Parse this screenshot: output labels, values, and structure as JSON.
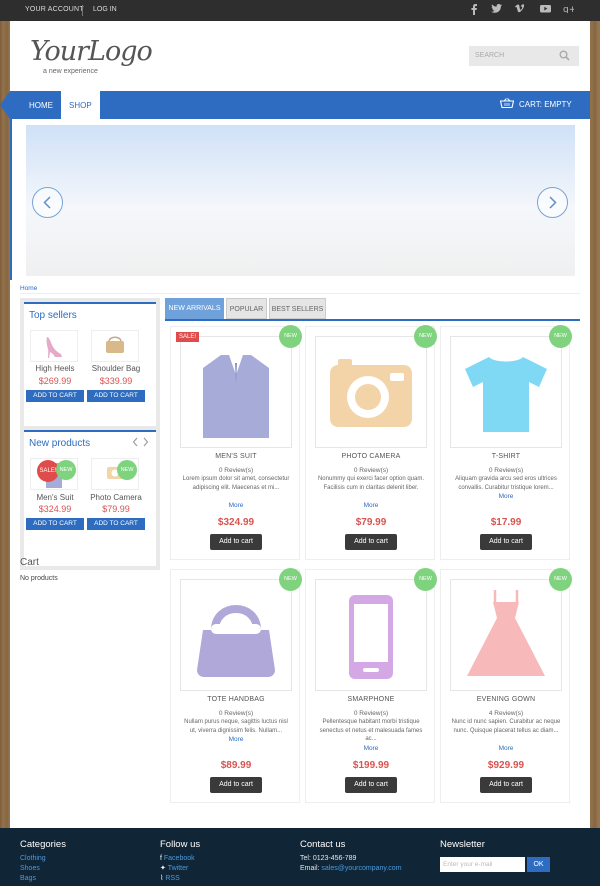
{
  "topbar": {
    "account": "YOUR ACCOUNT",
    "login": "LOG IN"
  },
  "logo": {
    "main": "YourLogo",
    "tagline": "a new experience"
  },
  "search": {
    "placeholder": "SEARCH"
  },
  "nav": {
    "home": "HOME",
    "shop": "SHOP",
    "cart": "CART: EMPTY"
  },
  "breadcrumb": "Home",
  "top_sellers": {
    "title": "Top sellers",
    "items": [
      {
        "name": "High Heels",
        "price": "$269.99",
        "button": "ADD TO CART"
      },
      {
        "name": "Shoulder Bag",
        "price": "$339.99",
        "button": "ADD TO CART"
      }
    ]
  },
  "new_products": {
    "title": "New products",
    "items": [
      {
        "name": "Men's Suit",
        "price": "$324.99",
        "button": "ADD TO CART",
        "sale": "SALE!",
        "badge": "NEW"
      },
      {
        "name": "Photo Camera",
        "price": "$79.99",
        "button": "ADD TO CART",
        "badge": "NEW"
      }
    ]
  },
  "cart": {
    "title": "Cart",
    "empty": "No products"
  },
  "tabs": [
    "NEW ARRIVALS",
    "POPULAR",
    "BEST SELLERS"
  ],
  "products": [
    {
      "name": "MEN'S SUIT",
      "reviews": "0 Review(s)",
      "desc": "Lorem ipsum dolor sit amet, consectetur adipiscing elit. Maecenas et mi...",
      "more": "More",
      "price": "$324.99",
      "button": "Add to cart",
      "badge": "NEW",
      "sale": "SALE!"
    },
    {
      "name": "PHOTO CAMERA",
      "reviews": "0 Review(s)",
      "desc": "Nonummy qui exerci facer option quam. Facilisis cum in claritas delenit liber.",
      "more": "More",
      "price": "$79.99",
      "button": "Add to cart",
      "badge": "NEW"
    },
    {
      "name": "T-SHIRT",
      "reviews": "0 Review(s)",
      "desc": "Aliquam gravida arcu sed eros ultrices convallis. Curabitur tristique lorem...",
      "more": "More",
      "price": "$17.99",
      "button": "Add to cart",
      "badge": "NEW"
    },
    {
      "name": "TOTE HANDBAG",
      "reviews": "0 Review(s)",
      "desc": "Nullam purus neque, sagittis luctus nisl ut, viverra dignissim felis. Nullam...",
      "more": "More",
      "price": "$89.99",
      "button": "Add to cart",
      "badge": "NEW"
    },
    {
      "name": "SMARPHONE",
      "reviews": "0 Review(s)",
      "desc": "Pellentesque habitant morbi tristique senectus et netus et malesuada fames ac...",
      "more": "More",
      "price": "$199.99",
      "button": "Add to cart",
      "badge": "NEW"
    },
    {
      "name": "EVENING GOWN",
      "reviews": "4 Review(s)",
      "desc": "Nunc id nunc sapien. Curabitur ac neque nunc. Quisque placerat tellus ac diam...",
      "more": "More",
      "price": "$929.99",
      "button": "Add to cart",
      "badge": "NEW"
    }
  ],
  "footer": {
    "categories": {
      "title": "Categories",
      "links": [
        "Clothing",
        "Shoes",
        "Bags"
      ]
    },
    "follow": {
      "title": "Follow us",
      "links": [
        "Facebook",
        "Twitter",
        "RSS"
      ]
    },
    "contact": {
      "title": "Contact us",
      "tel": "Tel: 0123-456-789",
      "email_label": "Email: ",
      "email": "sales@yourcompany.com"
    },
    "newsletter": {
      "title": "Newsletter",
      "placeholder": "Enter your e-mail",
      "button": "OK"
    }
  },
  "colors": {
    "accent": "#2d6cc0",
    "price": "#d9534f",
    "new_badge": "#7fd37f",
    "footer_bg": "#102536"
  },
  "icons": [
    "facebook-icon",
    "twitter-icon",
    "vimeo-icon",
    "youtube-icon",
    "googleplus-icon",
    "search-icon",
    "basket-icon",
    "chevron-left-icon",
    "chevron-right-icon"
  ]
}
